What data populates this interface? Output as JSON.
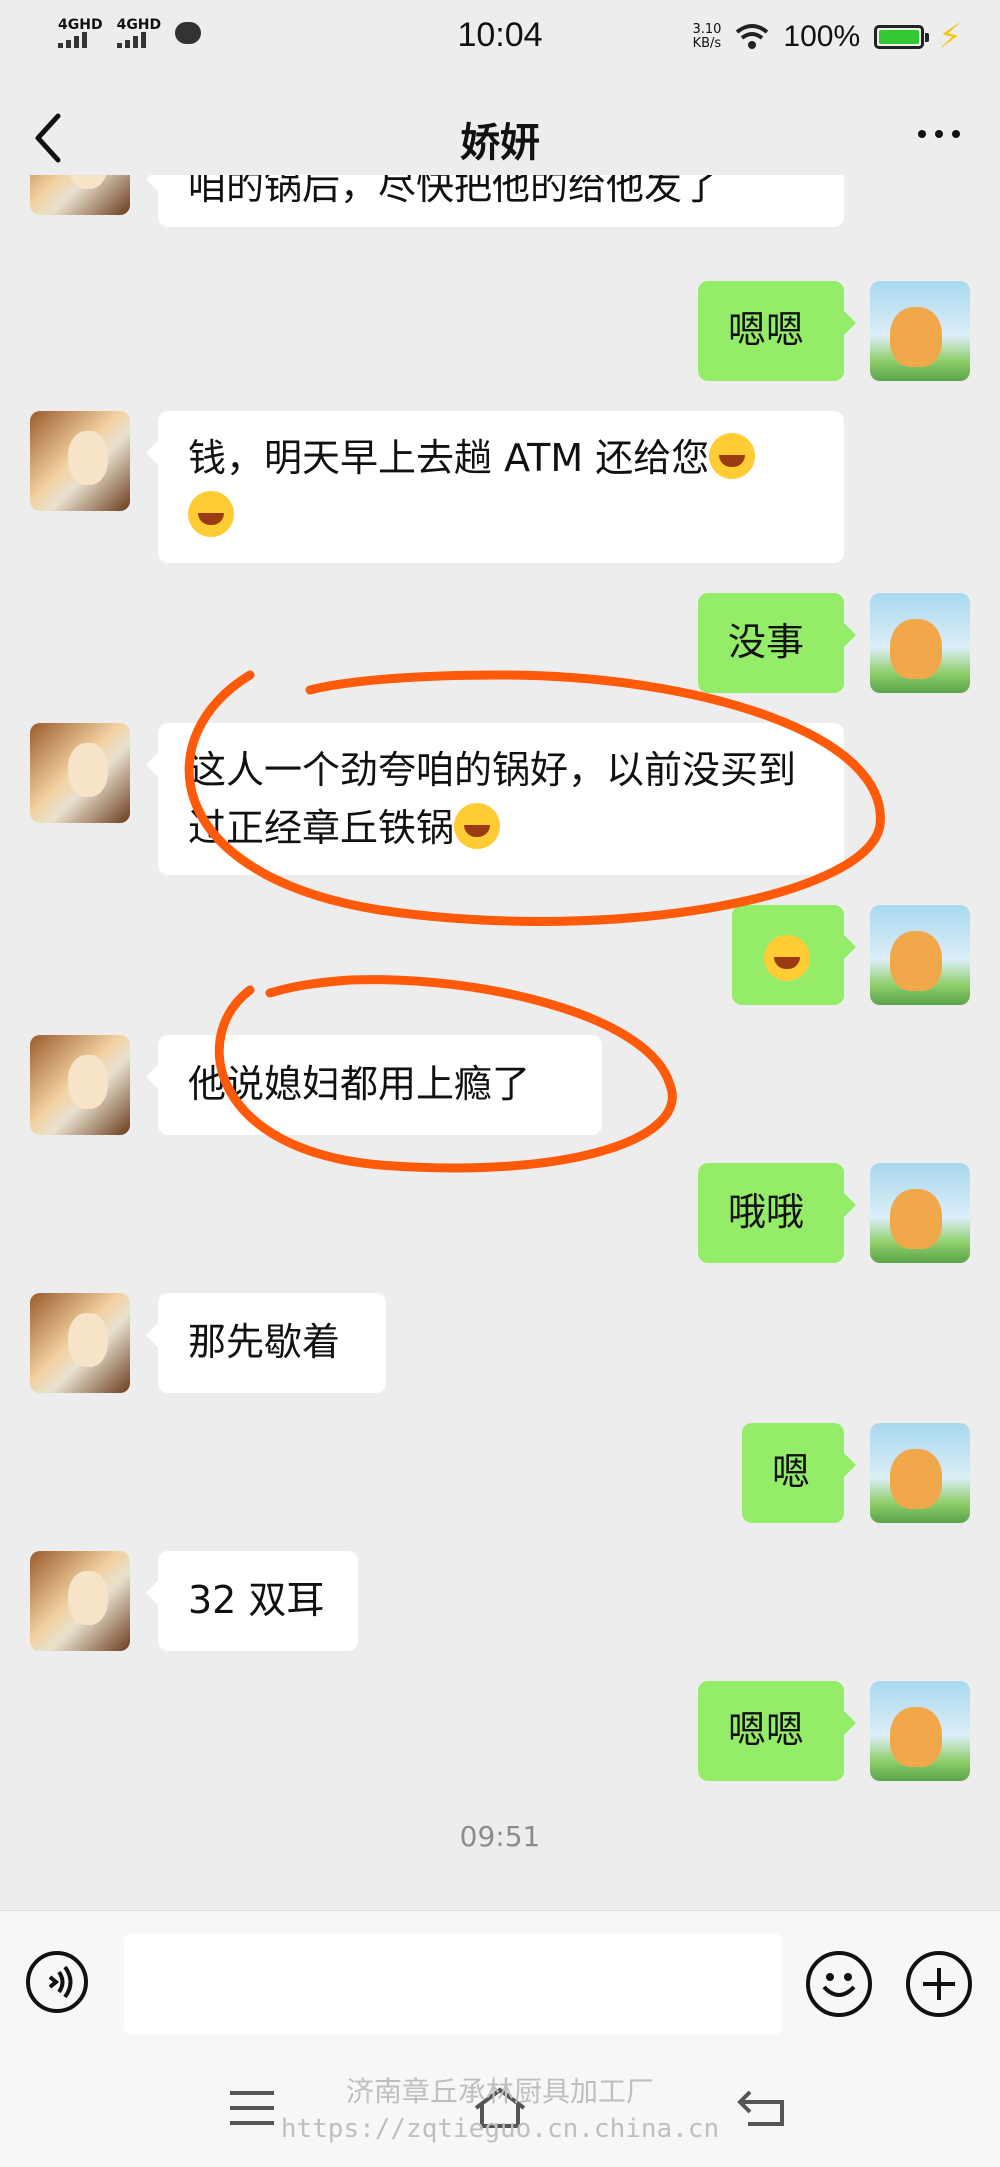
{
  "status_bar": {
    "net1": "4GHD",
    "net2": "4GHD",
    "time": "10:04",
    "speed_value": "3.10",
    "speed_unit": "KB/s",
    "battery": "100%"
  },
  "header": {
    "title": "娇妍"
  },
  "messages": [
    {
      "side": "in",
      "text": "咱的锅后，尽快把他的给他发了"
    },
    {
      "side": "out",
      "text": "嗯嗯"
    },
    {
      "side": "in",
      "text": "钱，明天早上去趟 ATM 还给您"
    },
    {
      "side": "out",
      "text": "没事"
    },
    {
      "side": "in",
      "text": "这人一个劲夸咱的锅好，以前没买到过正经章丘铁锅"
    },
    {
      "side": "out",
      "text": ""
    },
    {
      "side": "in",
      "text": "他说媳妇都用上瘾了"
    },
    {
      "side": "out",
      "text": "哦哦"
    },
    {
      "side": "in",
      "text": "那先歇着"
    },
    {
      "side": "out",
      "text": "嗯"
    },
    {
      "side": "in",
      "text": "32 双耳"
    },
    {
      "side": "out",
      "text": "嗯嗯"
    }
  ],
  "timestamp": "09:51",
  "watermark": {
    "line1": "济南章丘承林厨具加工厂",
    "line2": "https://zqtieguo.cn.china.cn"
  },
  "colors": {
    "background": "#ededed",
    "bubble_out": "#95ec69",
    "bubble_in": "#ffffff",
    "annotation": "#ff5a0a"
  }
}
